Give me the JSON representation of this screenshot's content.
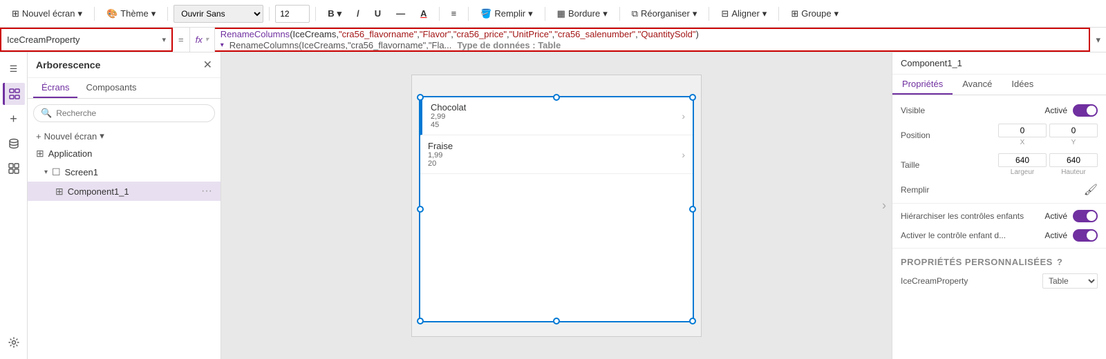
{
  "toolbar": {
    "new_screen_label": "Nouvel écran",
    "theme_label": "Thème",
    "font_label": "Ouvrir Sans",
    "font_size": "12",
    "bold_icon": "B",
    "italic_icon": "/",
    "underline_icon": "U",
    "strikethrough_icon": "—",
    "font_color_icon": "A",
    "align_icon": "≡",
    "fill_label": "Remplir",
    "border_label": "Bordure",
    "reorder_label": "Réorganiser",
    "align_label": "Aligner",
    "group_label": "Groupe"
  },
  "formula_bar": {
    "name": "IceCreamProperty",
    "eq": "=",
    "fx": "fx",
    "formula": "RenameColumns(IceCreams,\"cra56_flavorname\",\"Flavor\",\"cra56_price\",\"UnitPrice\",\"cra56_salenumber\",\"QuantitySold\")",
    "suggestion": "RenameColumns(IceCreams,\"cra56_flavorname\",\"Fla...",
    "data_type_label": "Type de données : Table"
  },
  "tree": {
    "title": "Arborescence",
    "tabs": [
      "Écrans",
      "Composants"
    ],
    "active_tab": 0,
    "search_placeholder": "Recherche",
    "add_screen_label": "Nouvel écran",
    "items": [
      {
        "id": "application",
        "label": "Application",
        "icon": "⊞",
        "indent": 0,
        "chevron": false
      },
      {
        "id": "screen1",
        "label": "Screen1",
        "icon": "☐",
        "indent": 1,
        "chevron": true,
        "expanded": true
      },
      {
        "id": "component1_1",
        "label": "Component1_1",
        "icon": "⊞",
        "indent": 2,
        "chevron": false,
        "selected": true,
        "dots": true
      }
    ]
  },
  "canvas": {
    "component_title": "Component1_1",
    "items": [
      {
        "id": 1,
        "title": "Chocolat",
        "sub": "2,99\n45",
        "active": true
      },
      {
        "id": 2,
        "title": "Fraise",
        "sub": "1,99\n20",
        "active": false
      }
    ]
  },
  "properties": {
    "component_name": "Component1_1",
    "tabs": [
      "Propriétés",
      "Avancé",
      "Idées"
    ],
    "active_tab": 0,
    "fields": {
      "visible_label": "Visible",
      "visible_value": "Activé",
      "position_label": "Position",
      "position_x": "0",
      "position_y": "0",
      "x_label": "X",
      "y_label": "Y",
      "size_label": "Taille",
      "size_w": "640",
      "size_h": "640",
      "w_label": "Largeur",
      "h_label": "Hauteur",
      "fill_label": "Remplir",
      "hierarchy_label": "Hiérarchiser les contrôles enfants",
      "hierarchy_value": "Activé",
      "child_ctrl_label": "Activer le contrôle enfant d...",
      "child_ctrl_value": "Activé",
      "custom_props_title": "PROPRIÉTÉS PERSONNALISÉES",
      "ice_creams_label": "IceCreamProperty",
      "ice_creams_value": "Table"
    }
  }
}
